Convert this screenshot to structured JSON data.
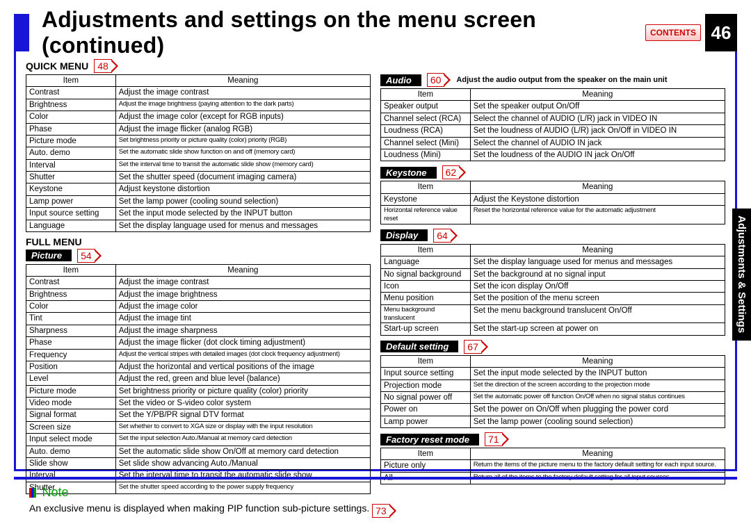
{
  "header": {
    "title": "Adjustments and settings on the menu screen (continued)",
    "contents_label": "CONTENTS",
    "page_number": "46"
  },
  "side_tab": "Adjustments & Settings",
  "quick_menu": {
    "label": "QUICK MENU",
    "page_ref": "48",
    "headers": [
      "Item",
      "Meaning"
    ],
    "rows": [
      [
        "Contrast",
        "Adjust the image contrast"
      ],
      [
        "Brightness",
        "Adjust the image brightness (paying attention to the dark parts)"
      ],
      [
        "Color",
        "Adjust the image color (except for RGB inputs)"
      ],
      [
        "Phase",
        "Adjust the image flicker (analog RGB)"
      ],
      [
        "Picture mode",
        "Set brightness priority or picture quality (color) priority (RGB)"
      ],
      [
        "Auto. demo",
        "Set the automatic slide show function on and off (memory card)"
      ],
      [
        "Interval",
        "Set the interval time to transit the automatic slide show (memory card)"
      ],
      [
        "Shutter",
        "Set the shutter speed (document imaging camera)"
      ],
      [
        "Keystone",
        "Adjust keystone distortion"
      ],
      [
        "Lamp power",
        "Set the lamp power (cooling sound selection)"
      ],
      [
        "Input source setting",
        "Set the input mode selected by the INPUT button"
      ],
      [
        "Language",
        "Set the display language used for menus and messages"
      ]
    ]
  },
  "full_menu_label": "FULL MENU",
  "picture": {
    "label": "Picture",
    "page_ref": "54",
    "headers": [
      "Item",
      "Meaning"
    ],
    "rows": [
      [
        "Contrast",
        "Adjust the image contrast"
      ],
      [
        "Brightness",
        "Adjust the image brightness"
      ],
      [
        "Color",
        "Adjust the image color"
      ],
      [
        "Tint",
        "Adjust the image tint"
      ],
      [
        "Sharpness",
        "Adjust the image sharpness"
      ],
      [
        "Phase",
        "Adjust the image flicker (dot clock timing adjustment)"
      ],
      [
        "Frequency",
        "Adjust the vertical stripes with detailed images (dot clock frequency adjustment)"
      ],
      [
        "Position",
        "Adjust the horizontal and vertical positions of the image"
      ],
      [
        "Level",
        "Adjust the red, green and blue level (balance)"
      ],
      [
        "Picture mode",
        "Set brightness priority or picture quality (color) priority"
      ],
      [
        "Video mode",
        "Set the video or S-video color system"
      ],
      [
        "Signal format",
        "Set the Y/PB/PR signal DTV format"
      ],
      [
        "Screen size",
        "Set whether to convert to XGA size or display with the input resolution"
      ],
      [
        "Input select mode",
        "Set the input selection Auto./Manual at memory card detection"
      ],
      [
        "Auto. demo",
        "Set the automatic slide show On/Off at memory card detection"
      ],
      [
        "Slide show",
        "Set slide show advancing Auto./Manual"
      ],
      [
        "Interval",
        "Set the interval time to transit the automatic slide show"
      ],
      [
        "Shutter",
        "Set the shutter speed according to the power supply frequency"
      ]
    ]
  },
  "audio": {
    "label": "Audio",
    "page_ref": "60",
    "note": "Adjust the audio output from the speaker on the main unit",
    "headers": [
      "Item",
      "Meaning"
    ],
    "rows": [
      [
        "Speaker output",
        "Set the speaker output On/Off"
      ],
      [
        "Channel select (RCA)",
        "Select the channel of AUDIO (L/R) jack in VIDEO IN"
      ],
      [
        "Loudness (RCA)",
        "Set the loudness of AUDIO (L/R) jack On/Off in VIDEO IN"
      ],
      [
        "Channel select (Mini)",
        "Select the channel of AUDIO IN jack"
      ],
      [
        "Loudness (Mini)",
        "Set the loudness of the AUDIO IN jack On/Off"
      ]
    ]
  },
  "keystone": {
    "label": "Keystone",
    "page_ref": "62",
    "headers": [
      "Item",
      "Meaning"
    ],
    "rows": [
      [
        "Keystone",
        "Adjust the Keystone distortion"
      ],
      [
        "Horizontal reference value reset",
        "Reset the horizontal reference value for the automatic adjustment"
      ]
    ]
  },
  "display": {
    "label": "Display",
    "page_ref": "64",
    "headers": [
      "Item",
      "Meaning"
    ],
    "rows": [
      [
        "Language",
        "Set the display language used for menus and messages"
      ],
      [
        "No signal background",
        "Set the background at no signal input"
      ],
      [
        "Icon",
        "Set the icon display On/Off"
      ],
      [
        "Menu position",
        "Set the position of the menu screen"
      ],
      [
        "Menu background translucent",
        "Set the menu background translucent On/Off"
      ],
      [
        "Start-up screen",
        "Set the start-up screen at power on"
      ]
    ]
  },
  "default_setting": {
    "label": "Default setting",
    "page_ref": "67",
    "headers": [
      "Item",
      "Meaning"
    ],
    "rows": [
      [
        "Input source setting",
        "Set the input mode selected by the INPUT button"
      ],
      [
        "Projection mode",
        "Set the direction of the screen according to the projection mode"
      ],
      [
        "No signal power off",
        "Set the automatic power off function On/Off when no signal status continues"
      ],
      [
        "Power on",
        "Set the power on On/Off when plugging the power cord"
      ],
      [
        "Lamp power",
        "Set the lamp power (cooling sound selection)"
      ]
    ]
  },
  "factory_reset": {
    "label": "Factory reset mode",
    "page_ref": "71",
    "headers": [
      "Item",
      "Meaning"
    ],
    "rows": [
      [
        "Picture only",
        "Return the items of the picture menu to the factory default setting for each input source."
      ],
      [
        "All",
        "Return all of the items to the factory default setting for all input sources."
      ]
    ]
  },
  "note": {
    "label": "Note",
    "text": "An exclusive menu is displayed when making PIP function sub-picture settings.",
    "page_ref": "73"
  }
}
